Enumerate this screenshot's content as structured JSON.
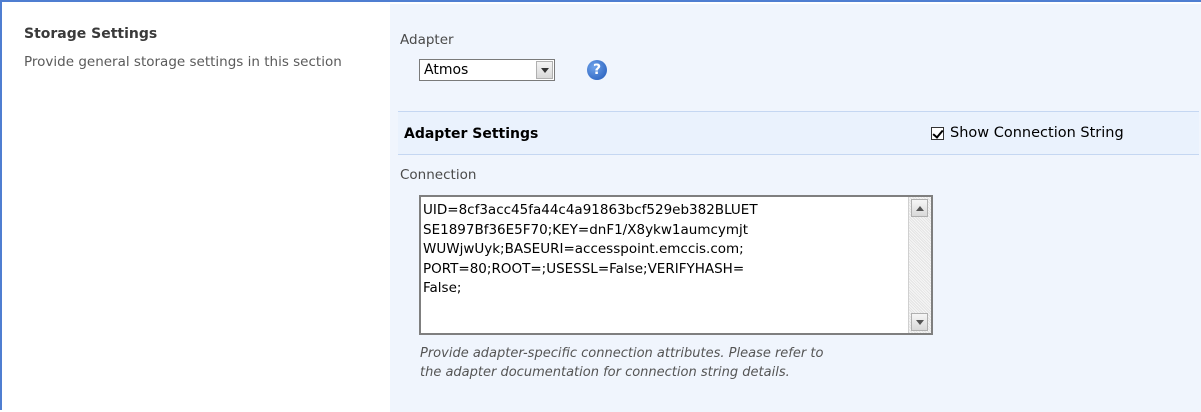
{
  "section": {
    "title": "Storage Settings",
    "description": "Provide general storage settings in this section"
  },
  "adapter": {
    "label": "Adapter",
    "selected": "Atmos",
    "help_icon": "help-icon"
  },
  "adapter_settings": {
    "title": "Adapter Settings",
    "show_connection_string": {
      "label": "Show Connection String",
      "checked": true
    }
  },
  "connection": {
    "label": "Connection",
    "lines": [
      "UID=8cf3acc45fa44c4a91863bcf529eb382BLUET",
      "SE1897Bf36E5F70;KEY=dnF1/X8ykw1aumcymjt",
      "WUWjwUyk;BASEURI=accesspoint.emccis.com;",
      "PORT=80;ROOT=;USESSL=False;VERIFYHASH=",
      "False;"
    ],
    "hint_lines": [
      "Provide adapter-specific connection attributes. Please refer to",
      "the adapter documentation for connection string details."
    ]
  },
  "colors": {
    "frame_border": "#4f7ed1",
    "panel_bg": "#f0f5fd",
    "settings_bar_bg": "#eaf2fd",
    "help_icon": "#2a66c4"
  }
}
